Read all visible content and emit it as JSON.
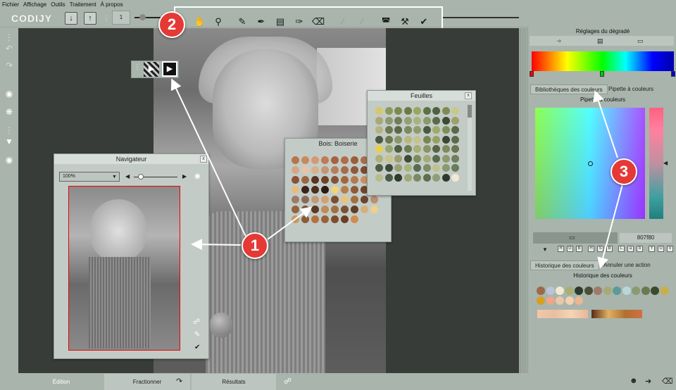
{
  "menu": [
    "Fichier",
    "Affichage",
    "Outils",
    "Traitement",
    "À propos"
  ],
  "app": {
    "logo_text": "CODIJY"
  },
  "toolbar": {
    "page_number": "1"
  },
  "markers": {
    "m1": "1",
    "m2": "2",
    "m3": "3"
  },
  "navigator": {
    "title": "Navigateur",
    "zoom": "100%",
    "close": "x"
  },
  "wood_panel": {
    "title": "Bois: Boiserie",
    "close": "x",
    "colors": [
      "#b5774a",
      "#c88a5c",
      "#d69870",
      "#c17a55",
      "#a8613e",
      "#b06d45",
      "#9a5e3a",
      "#a86c4a",
      "#c48867",
      "#d8a584",
      "#e7c3a5",
      "#d9b08b",
      "#c69573",
      "#b67e5e",
      "#a66c4b",
      "#8e5a3c",
      "#7a4a30",
      "#6b3f28",
      "#8a5236",
      "#9d6543",
      "#5a3322",
      "#6f4129",
      "#83513a",
      "#a0673f",
      "#b27a4f",
      "#c79060",
      "#daa76f",
      "#e6bc83",
      "#3a231a",
      "#4c2e1e",
      "#2a1a14",
      "#f0d37a",
      "#b77d4b",
      "#8d5a37",
      "#6f4428",
      "#5a3420",
      "#9e7a6a",
      "#8a6a5a",
      "#c29a7a",
      "#d2a071",
      "#7a5030",
      "#e8c37e",
      "#a0703f",
      "#6a4530",
      "#b89070",
      "#94633f",
      "#7a4f33",
      "#5c3925",
      "#c08b56",
      "#a06f42",
      "#7a5232",
      "#603e27",
      "#d6b07a",
      "#efcf8a",
      "#c69a5e",
      "#8a5c35",
      "#b3713d",
      "#9a6038",
      "#7e4c2c",
      "#6a3f24",
      "#d08c4e"
    ]
  },
  "leaves_panel": {
    "title": "Feuilles",
    "close": "x",
    "colors": [
      "#d4c86a",
      "#8a9a5a",
      "#7a8a4e",
      "#6a7a44",
      "#9aa65e",
      "#5e7048",
      "#4e6040",
      "#7e8a52",
      "#c8c88a",
      "#a8a878",
      "#8e9870",
      "#6e7e5a",
      "#90a070",
      "#a6b47a",
      "#8a9a68",
      "#5a6a4a",
      "#3e4a34",
      "#9ea06a",
      "#b4b482",
      "#6a7850",
      "#5a6846",
      "#7a8a5e",
      "#8e9c6a",
      "#4a5a3e",
      "#a0aa6a",
      "#7e8e5a",
      "#5a6a48",
      "#4a5840",
      "#6a7a4e",
      "#8a966a",
      "#b6b87e",
      "#c4c48a",
      "#7a8652",
      "#96a264",
      "#3a4636",
      "#5e6a4c",
      "#e8d04a",
      "#9aa66a",
      "#4e5e42",
      "#6e7c54",
      "#a8b070",
      "#8a9462",
      "#5a6444",
      "#7e8a5a",
      "#6a7450",
      "#b0b07a",
      "#c8c48a",
      "#9e9e6e",
      "#3e4a3a",
      "#7a8a5a",
      "#a6aa76",
      "#5a6c50",
      "#8e9a6a",
      "#6e7e5e",
      "#4e5c44",
      "#3a4838",
      "#9aa072",
      "#a6b47e",
      "#5a6a52",
      "#7e8c66",
      "#c0c090",
      "#8a9a70",
      "#6a7c5a",
      "#b8bc8c",
      "#4a5a46",
      "#2e3a2e",
      "#9ea878",
      "#7a8a62",
      "#5e6e50",
      "#8e9e76",
      "#2c3830",
      "#f0ead2"
    ]
  },
  "right_panel": {
    "gradient_title": "Réglages du dégradé",
    "tab_libraries": "Bibliothèques des couleurs",
    "tab_pipette": "Pipette à couleurs",
    "picker_title": "Pipette à couleurs",
    "hex_value": "807f80",
    "modes": [
      "R",
      "G",
      "B",
      "H",
      "S",
      "B",
      "L",
      "a",
      "b",
      "Y",
      "U",
      "V"
    ],
    "history_tab": "Historique des couleurs",
    "undo_tab": "Annuler une action",
    "history_title": "Historique des couleurs",
    "history_colors": [
      "#9a6a4a",
      "#b8c4d8",
      "#f0ead2",
      "#a8b070",
      "#2e3a2e",
      "#4a5038",
      "#9e7a6a",
      "#a6aa76",
      "#5a9a9a",
      "#b8d8d8",
      "#8a9a70",
      "#6a7a4e",
      "#3a4a2e",
      "#c8b048"
    ],
    "history_colors2": [
      "#d6a020",
      "#f0a488",
      "#e8c8a8",
      "#f4d0b0",
      "#e8b890"
    ]
  },
  "bottom_tabs": {
    "edition": "Édition",
    "fractionner": "Fractionner",
    "resultats": "Résultats"
  },
  "colors": {
    "accent_red": "#e53935",
    "canvas_bg": "#383c39",
    "ui_bg": "#a9b4ad"
  }
}
